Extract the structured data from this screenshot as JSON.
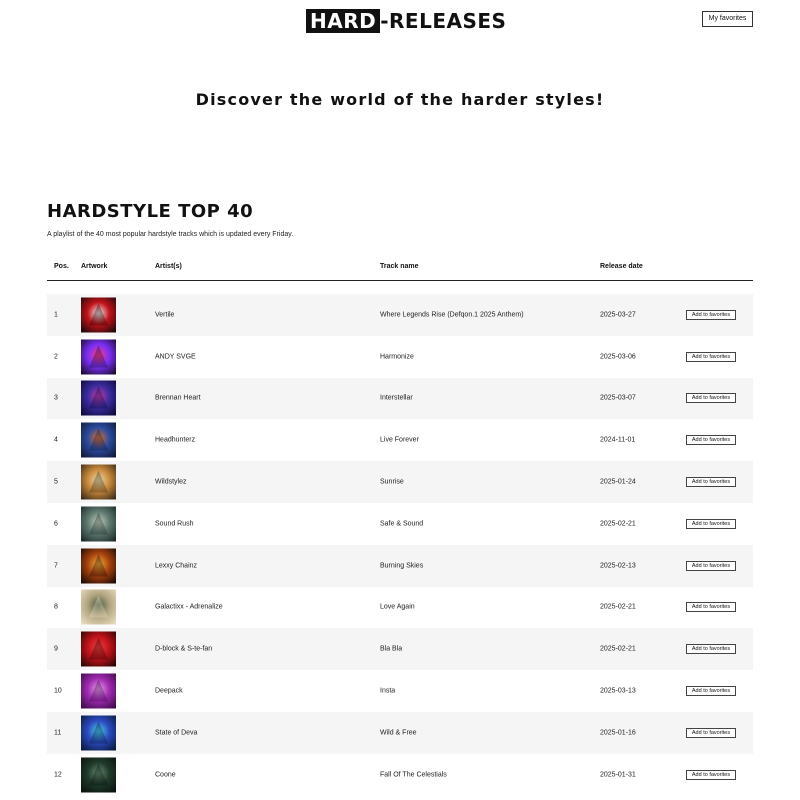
{
  "header": {
    "logo_box": "HARD",
    "logo_rest": "-RELEASES",
    "favorites_button": "My favorites"
  },
  "tagline": "Discover the world of the harder styles!",
  "playlist": {
    "title": "HARDSTYLE TOP 40",
    "description": "A playlist of the 40 most popular hardstyle tracks which is updated every Friday.",
    "columns": {
      "pos": "Pos.",
      "artwork": "Artwork",
      "artists": "Artist(s)",
      "track": "Track name",
      "release": "Release date"
    },
    "add_label": "Add to favorites",
    "rows": [
      {
        "pos": "1",
        "artist": "Vertile",
        "track": "Where Legends Rise (Defqon.1 2025 Anthem)",
        "date": "2025-03-27",
        "art": [
          "#1a0a0a",
          "#c2121a",
          "#f0f0f0"
        ]
      },
      {
        "pos": "2",
        "artist": "ANDY SVGE",
        "track": "Harmonize",
        "date": "2025-03-06",
        "art": [
          "#1a0b2e",
          "#7b2ff7",
          "#ff3d7f"
        ]
      },
      {
        "pos": "3",
        "artist": "Brennan Heart",
        "track": "Interstellar",
        "date": "2025-03-07",
        "art": [
          "#0e0a3a",
          "#3a2c9e",
          "#c43ca8"
        ]
      },
      {
        "pos": "4",
        "artist": "Headhunterz",
        "track": "Live Forever",
        "date": "2024-11-01",
        "art": [
          "#101a3a",
          "#2c4b9e",
          "#e0722a"
        ]
      },
      {
        "pos": "5",
        "artist": "Wildstylez",
        "track": "Sunrise",
        "date": "2025-01-24",
        "art": [
          "#3a2a1a",
          "#c98a3a",
          "#e8e0b0"
        ]
      },
      {
        "pos": "6",
        "artist": "Sound Rush",
        "track": "Safe & Sound",
        "date": "2025-02-21",
        "art": [
          "#1c2a2a",
          "#5f7a70",
          "#c8cfc0"
        ]
      },
      {
        "pos": "7",
        "artist": "Lexxy Chainz",
        "track": "Burning Skies",
        "date": "2025-02-13",
        "art": [
          "#1a0a05",
          "#a8420e",
          "#f2b03a"
        ]
      },
      {
        "pos": "8",
        "artist": "Galactixx - Adrenalize",
        "track": "Love Again",
        "date": "2025-02-21",
        "art": [
          "#e8dcc0",
          "#b0a480",
          "#4a5a40"
        ]
      },
      {
        "pos": "9",
        "artist": "D-block & S-te-fan",
        "track": "Bla Bla",
        "date": "2025-02-21",
        "art": [
          "#2a0505",
          "#c0121a",
          "#f04040"
        ]
      },
      {
        "pos": "10",
        "artist": "Deepack",
        "track": "Insta",
        "date": "2025-03-13",
        "art": [
          "#3a0a4a",
          "#a02ab0",
          "#e8a0e8"
        ]
      },
      {
        "pos": "11",
        "artist": "State of Deva",
        "track": "Wild & Free",
        "date": "2025-01-16",
        "art": [
          "#0a1a3a",
          "#2a4ac0",
          "#4ad0e8"
        ]
      },
      {
        "pos": "12",
        "artist": "Coone",
        "track": "Fall Of The Celestials",
        "date": "2025-01-31",
        "art": [
          "#0a120e",
          "#1f3a2a",
          "#6a8a70"
        ]
      }
    ]
  }
}
